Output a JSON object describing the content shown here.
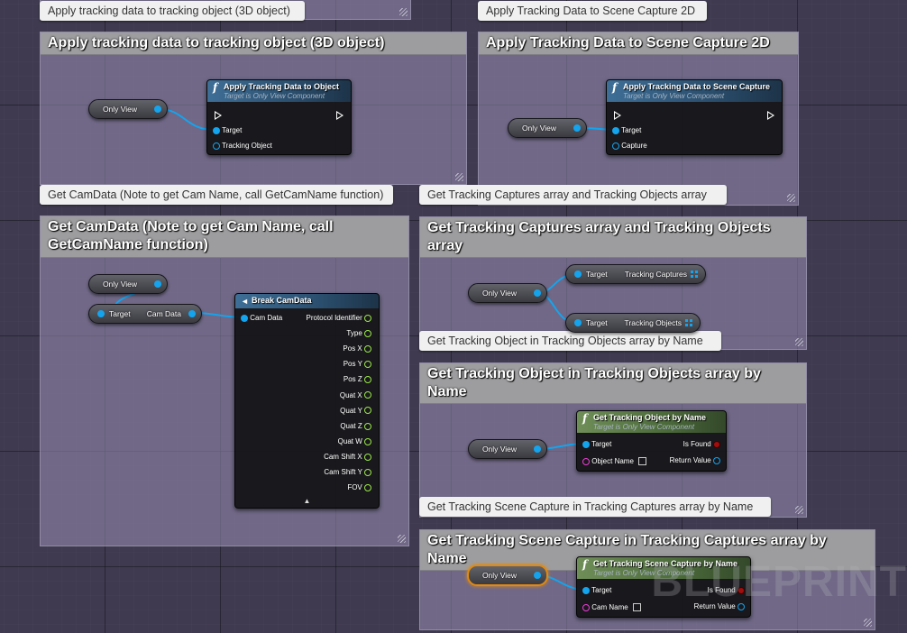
{
  "colors": {
    "wire_object": "#14a4ee",
    "struct_pin": "#9ae94a",
    "name_pin": "#ee3dd8",
    "bool_pin": "#a00e0e",
    "selected_outline": "#e08a12"
  },
  "icons": {
    "function": "f",
    "break_struct": "split-icon",
    "array": "grid-icon"
  },
  "comments": [
    {
      "id": "c1",
      "bubble": "Apply tracking data to tracking object (3D object)",
      "title": "Apply tracking data to tracking object (3D object)"
    },
    {
      "id": "c2",
      "bubble": "Apply Tracking Data to Scene Capture 2D",
      "title": "Apply Tracking Data to Scene Capture 2D"
    },
    {
      "id": "c3",
      "bubble": "Get CamData (Note to get Cam Name, call GetCamName function)",
      "title": "Get CamData (Note to get Cam Name, call GetCamName function)"
    },
    {
      "id": "c4",
      "bubble": "Get Tracking Captures array and Tracking Objects array",
      "title": "Get Tracking Captures array and Tracking Objects array"
    },
    {
      "id": "c5",
      "bubble": "Get Tracking Object in Tracking Objects array by Name",
      "title": "Get Tracking Object in Tracking Objects array by Name"
    },
    {
      "id": "c6",
      "bubble": "Get Tracking Scene Capture in Tracking Captures array by Name",
      "title": "Get Tracking Scene Capture in Tracking Captures array by Name"
    }
  ],
  "getters": {
    "only_view": "Only View",
    "target_camdata": {
      "left": "Target",
      "right": "Cam Data"
    },
    "target_captures": {
      "left": "Target",
      "right": "Tracking Captures"
    },
    "target_objects": {
      "left": "Target",
      "right": "Tracking Objects"
    }
  },
  "nodes": {
    "apply_object": {
      "title": "Apply Tracking Data to Object",
      "subtitle": "Target is Only View Component",
      "pins": [
        "Target",
        "Tracking Object"
      ]
    },
    "apply_capture": {
      "title": "Apply Tracking Data to Scene Capture",
      "subtitle": "Target is Only View Component",
      "pins": [
        "Target",
        "Capture"
      ]
    },
    "break_camdata": {
      "title": "Break CamData",
      "input": "Cam Data",
      "outputs": [
        "Protocol Identifier",
        "Type",
        "Pos X",
        "Pos Y",
        "Pos Z",
        "Quat X",
        "Quat Y",
        "Quat Z",
        "Quat W",
        "Cam Shift X",
        "Cam Shift Y",
        "FOV"
      ]
    },
    "get_object_by_name": {
      "title": "Get Tracking Object by Name",
      "subtitle": "Target is Only View Component",
      "in": [
        "Target",
        "Object Name"
      ],
      "out": [
        "Is Found",
        "Return Value"
      ]
    },
    "get_capture_by_name": {
      "title": "Get Tracking Scene Capture by Name",
      "subtitle": "Target is Only View Component",
      "in": [
        "Target",
        "Cam Name"
      ],
      "out": [
        "Is Found",
        "Return Value"
      ]
    }
  },
  "watermark": "BLUEPRINT"
}
